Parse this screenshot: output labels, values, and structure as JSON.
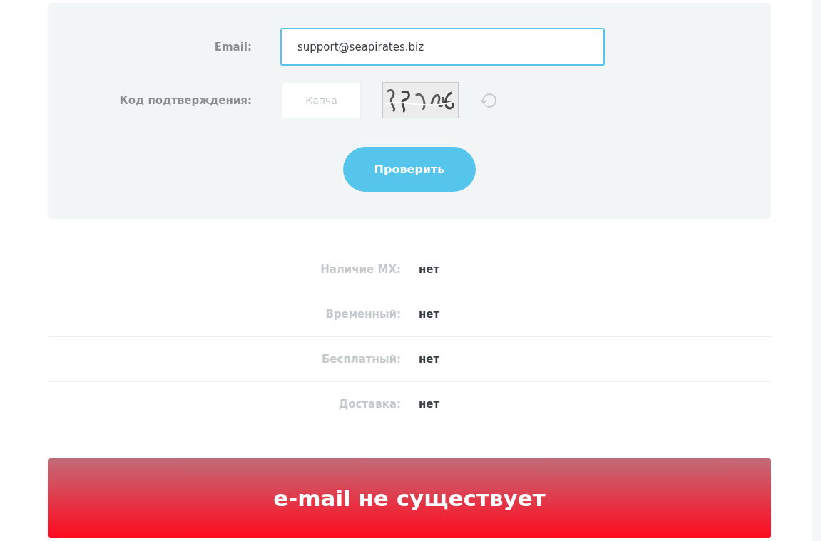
{
  "form": {
    "email": {
      "label": "Email:",
      "value": "support@seapirates.biz",
      "focused": true
    },
    "captcha": {
      "label": "Код подтверждения:",
      "placeholder": "Капча"
    },
    "submit": "Проверить"
  },
  "results": [
    {
      "label": "Наличие MX:",
      "value": "нет"
    },
    {
      "label": "Временный:",
      "value": "нет"
    },
    {
      "label": "Бесплатный:",
      "value": "нет"
    },
    {
      "label": "Доставка:",
      "value": "нет"
    }
  ],
  "verdict": {
    "text": "e-mail не существует",
    "error": true
  }
}
